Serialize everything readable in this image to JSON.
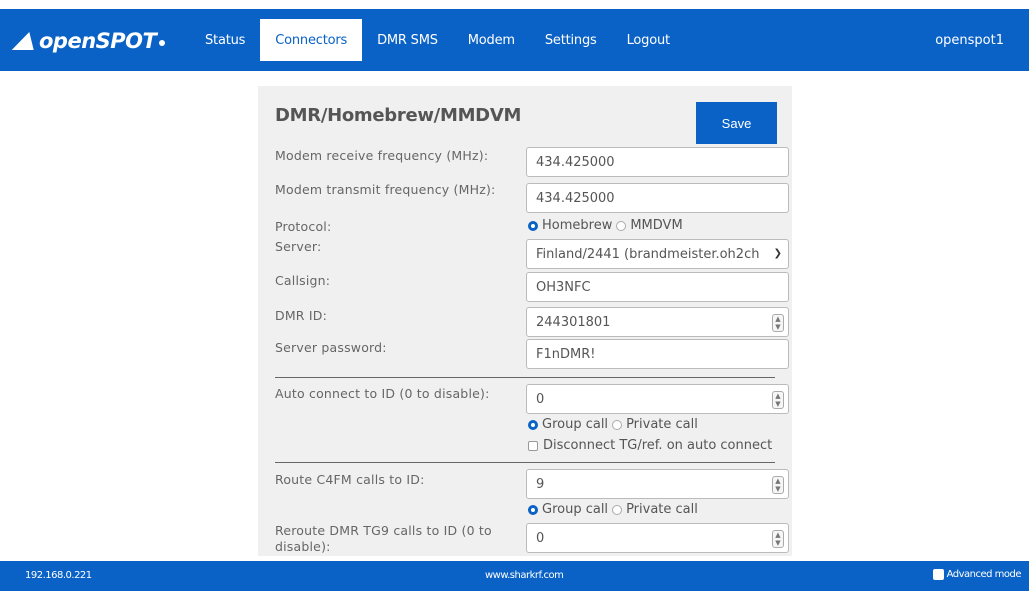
{
  "nav": {
    "logo_text": "openSPOT",
    "items": [
      "Status",
      "Connectors",
      "DMR SMS",
      "Modem",
      "Settings",
      "Logout"
    ],
    "active": "Connectors",
    "user": "openspot1"
  },
  "panel": {
    "title": "DMR/Homebrew/MMDVM",
    "save_label": "Save",
    "fields": {
      "rx_freq": {
        "label": "Modem receive frequency (MHz):",
        "value": "434.425000"
      },
      "tx_freq": {
        "label": "Modem transmit frequency (MHz):",
        "value": "434.425000"
      },
      "protocol": {
        "label": "Protocol:",
        "options": [
          "Homebrew",
          "MMDVM"
        ],
        "selected": "Homebrew"
      },
      "server": {
        "label": "Server:",
        "value": "Finland/2441 (brandmeister.oh2ch"
      },
      "callsign": {
        "label": "Callsign:",
        "value": "OH3NFC"
      },
      "dmr_id": {
        "label": "DMR ID:",
        "value": "244301801"
      },
      "password": {
        "label": "Server password:",
        "value": "F1nDMR!"
      },
      "auto_connect": {
        "label": "Auto connect to ID (0 to disable):",
        "value": "0",
        "call_options": [
          "Group call",
          "Private call"
        ],
        "selected": "Group call",
        "disconnect_label": "Disconnect TG/ref. on auto connect"
      },
      "route_c4fm": {
        "label": "Route C4FM calls to ID:",
        "value": "9",
        "call_options": [
          "Group call",
          "Private call"
        ],
        "selected": "Group call"
      },
      "reroute_tg9": {
        "label": "Reroute DMR TG9 calls to ID (0 to disable):",
        "value": "0"
      }
    }
  },
  "footer": {
    "ip": "192.168.0.221",
    "site": "www.sharkrf.com",
    "advanced_label": "Advanced mode"
  },
  "colors": {
    "brand": "#0a62c6",
    "panel_bg": "#f0f0f0"
  }
}
